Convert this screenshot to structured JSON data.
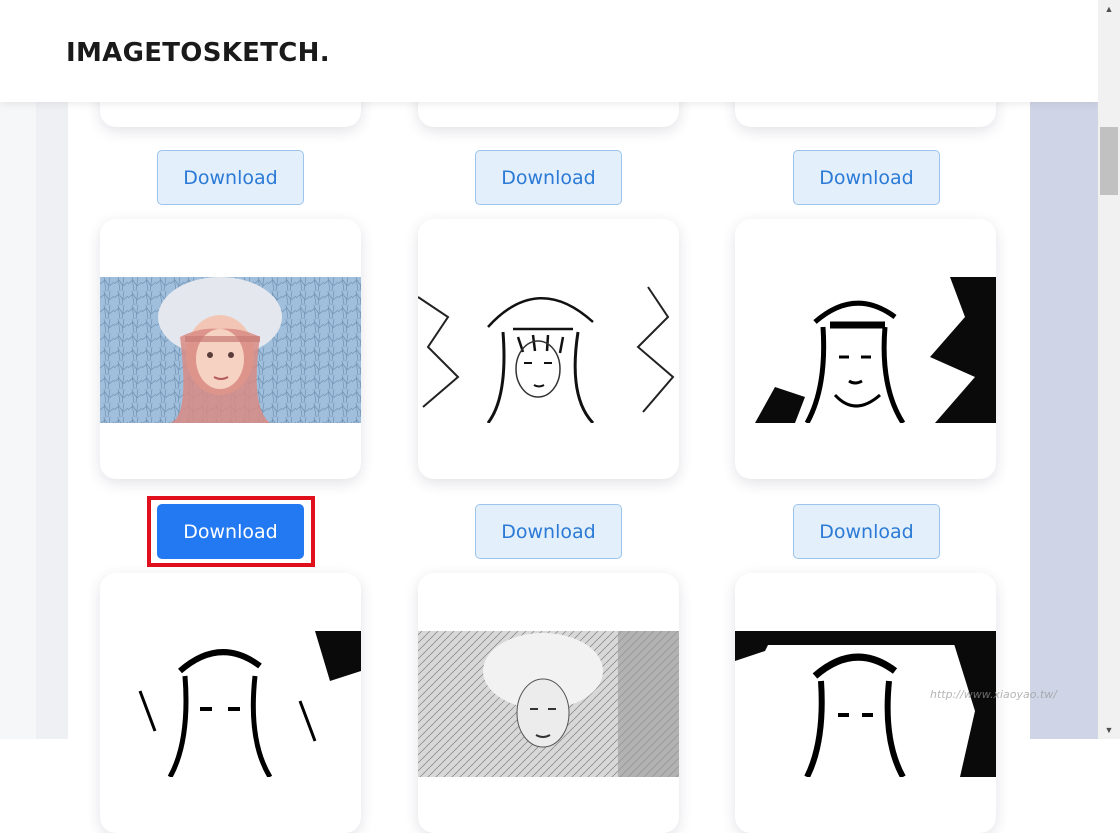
{
  "header": {
    "logo_text": "IMAGETOSKETCH."
  },
  "gallery": {
    "download_label": "Download",
    "active_button_color": "#2279f2",
    "button_color": "#e3effb",
    "highlight_color": "#e0101c"
  },
  "watermark": {
    "text": "http://www.xiaoyao.tw/"
  },
  "scrollbar": {
    "up_icon": "▲",
    "down_icon": "▼"
  }
}
